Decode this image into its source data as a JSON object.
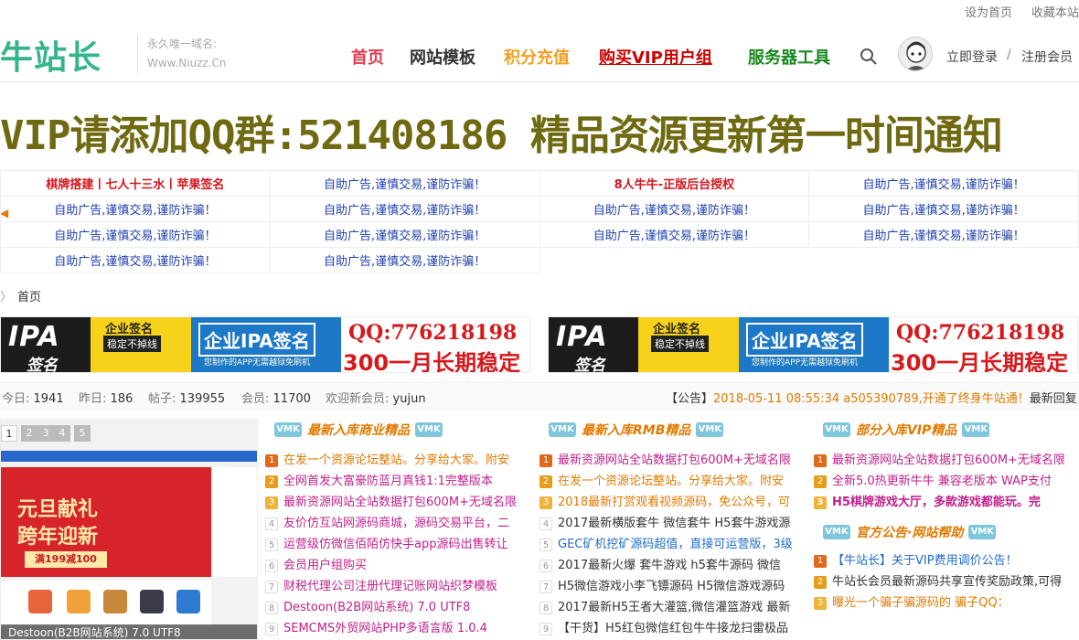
{
  "topbar": {
    "set_home": "设为首页",
    "bookmark": "收藏本站"
  },
  "header": {
    "logo": "牛站长",
    "slogan": "永久唯一域名:",
    "domain": "Www.Niuzz.Cn",
    "nav": [
      {
        "label": "首页",
        "color": "#e23c52"
      },
      {
        "label": "网站模板",
        "color": "#333333"
      },
      {
        "label": "积分充值",
        "color": "#f0a020"
      },
      {
        "label": "购买VIP用户组",
        "color": "#cc0000"
      },
      {
        "label": "服务器工具",
        "color": "#18891e"
      }
    ],
    "login": "立即登录",
    "sep": "/",
    "register": "注册会员"
  },
  "banner": "VIP请添加QQ群:521408186 精品资源更新第一时间通知",
  "ad_grid": [
    [
      "棋牌搭建丨七人十三水丨苹果签名",
      "自助广告,谨慎交易,谨防诈骗！",
      "8人牛牛-正版后台授权",
      "自助广告,谨慎交易,谨防诈骗！"
    ],
    [
      "自助广告,谨慎交易,谨防诈骗！",
      "自助广告,谨慎交易,谨防诈骗！",
      "自助广告,谨慎交易,谨防诈骗！",
      "自助广告,谨慎交易,谨防诈骗！"
    ],
    [
      "自助广告,谨慎交易,谨防诈骗！",
      "自助广告,谨慎交易,谨防诈骗！",
      "自助广告,谨慎交易,谨防诈骗！",
      "自助广告,谨慎交易,谨防诈骗！"
    ],
    [
      "自助广告,谨慎交易,谨防诈骗！",
      "自助广告,谨慎交易,谨防诈骗！",
      "",
      ""
    ]
  ],
  "breadcrumb": {
    "sep": "〉",
    "home": "首页"
  },
  "ipa_ad": {
    "logo_top": "IPA",
    "logo_bottom": "签名",
    "tag1": "企业签名",
    "tag2": "稳定不掉线",
    "title": "企业IPA签名",
    "subtitle": "您制作的APP无需越狱免刷机",
    "qq": "QQ:776218198",
    "price": "300一月长期稳定"
  },
  "stats": {
    "today_label": "今日:",
    "today": "1941",
    "yesterday_label": "昨日:",
    "yesterday": "186",
    "posts_label": "帖子:",
    "posts": "139955",
    "members_label": "会员:",
    "members": "11700",
    "welcome_label": "欢迎新会员:",
    "newest": "yujun"
  },
  "notice": {
    "tag": "【公告】",
    "date": "2018-05-11 08:55:34",
    "text": "a505390789,开通了终身牛站通！",
    "more": "最新回复"
  },
  "slider": {
    "pages": [
      "1",
      "2",
      "3",
      "4",
      "5"
    ],
    "hero_line1": "元旦献礼",
    "hero_line2": "跨年迎新",
    "hero_button": "满199减100",
    "caption": "Destoon(B2B网站系统) 7.0 UTF8"
  },
  "columns": [
    {
      "badge": "VMK",
      "title": "最新入库商业精品",
      "items": [
        {
          "text": "在发一个资源论坛整站。分享给大家。附安",
          "color": "#e07a00"
        },
        {
          "text": "全网首发大富豪防蓝月真钱1:1完整版本",
          "color": "#c01f8c"
        },
        {
          "text": "最新资源网站全站数据打包600M+无域名限",
          "color": "#c01f8c"
        },
        {
          "text": "友价仿互站网源码商城，源码交易平台，二",
          "color": "#c01f8c"
        },
        {
          "text": "运营级仿微信佰陌仿快手app源码出售转让",
          "color": "#c01f8c"
        },
        {
          "text": "会员用户组购买",
          "color": "#c01f8c"
        },
        {
          "text": "财税代理公司注册代理记账网站织梦模板",
          "color": "#c01f8c"
        },
        {
          "text": "Destoon(B2B网站系统) 7.0 UTF8",
          "color": "#c01f8c"
        },
        {
          "text": "SEMCMS外贸网站PHP多语言版 1.0.4",
          "color": "#c01f8c"
        }
      ]
    },
    {
      "badge": "VMK",
      "title": "最新入库RMB精品",
      "items": [
        {
          "text": "最新资源网站全站数据打包600M+无域名限",
          "color": "#c01f8c"
        },
        {
          "text": "在发一个资源论坛整站。分享给大家。附安",
          "color": "#e07a00"
        },
        {
          "text": "2018最新打赏观看视频源码，免公众号，可",
          "color": "#e07a00"
        },
        {
          "text": "2017最新横版套牛 微信套牛 H5套牛游戏源",
          "color": "#333333"
        },
        {
          "text": "GEC矿机挖矿源码超值，直接可运营版，3级",
          "color": "#1f6bc9"
        },
        {
          "text": "2017最新火爆 套牛游戏 h5套牛源码 微信",
          "color": "#333333"
        },
        {
          "text": "H5微信游戏小李飞镖源码 H5微信游戏源码",
          "color": "#333333"
        },
        {
          "text": "2017最新H5王者大灌篮,微信灌篮游戏 最新",
          "color": "#333333"
        },
        {
          "text": "【干货】H5红包微信红包牛牛接龙扫雷极品",
          "color": "#333333"
        }
      ]
    },
    {
      "badge": "VMK",
      "title": "部分入库VIP精品",
      "items": [
        {
          "text": "最新资源网站全站数据打包600M+无域名限",
          "color": "#c01f8c"
        },
        {
          "text": "全新5.0热更新牛牛 兼容老版本 WAP支付",
          "color": "#c01f8c"
        },
        {
          "text": "H5棋牌游戏大厅，多款游戏都能玩。完",
          "color": "#c01f8c"
        }
      ],
      "sub_title": "官方公告·网站帮助",
      "sub_items": [
        {
          "text": "【牛站长】关于VIP费用调价公告！",
          "color": "#1f6bc9"
        },
        {
          "text": "牛站长会员最新源码共享宣传奖励政策,可得",
          "color": "#333333"
        },
        {
          "text": "曝光一个骗子骗源码的 骗子QQ：",
          "color": "#e07a00"
        }
      ]
    }
  ]
}
